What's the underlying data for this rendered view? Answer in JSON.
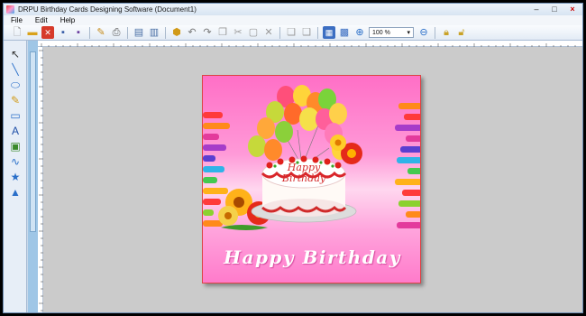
{
  "window": {
    "title": "DRPU Birthday Cards Designing Software  (Document1)",
    "controls": [
      "–",
      "□",
      "×"
    ]
  },
  "menu": [
    "File",
    "Edit",
    "Help"
  ],
  "toolbar": {
    "zoom_value": "100 %",
    "zoom_arrow": "▾"
  },
  "tools": [
    {
      "name": "pointer-tool",
      "glyph": "↖"
    },
    {
      "name": "line-tool",
      "glyph": "╲"
    },
    {
      "name": "ellipse-tool",
      "glyph": "⬭"
    },
    {
      "name": "pencil-tool",
      "glyph": "✎"
    },
    {
      "name": "rectangle-tool",
      "glyph": "▭"
    },
    {
      "name": "text-tool",
      "glyph": "A"
    },
    {
      "name": "image-tool",
      "glyph": "▣"
    },
    {
      "name": "curve-tool",
      "glyph": "∿"
    },
    {
      "name": "star-tool",
      "glyph": "★"
    },
    {
      "name": "triangle-tool",
      "glyph": "▲"
    }
  ],
  "card": {
    "cake_text_line1": "Happy",
    "cake_text_line2": "Birthday",
    "greeting": "Happy Birthday"
  },
  "colors": {
    "card_pink": "#ff7bcb",
    "canvas_gray": "#cbcbcb",
    "scroll_blue": "#9fc6e6"
  }
}
